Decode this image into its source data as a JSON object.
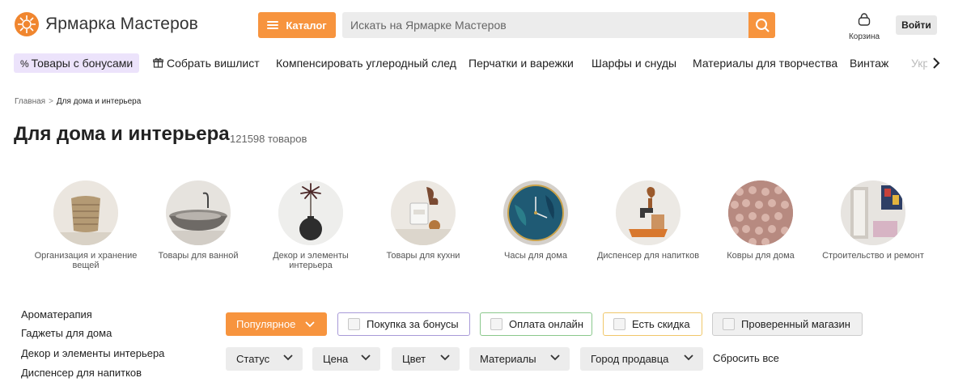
{
  "header": {
    "logo_text": "Ярмарка Мастеров",
    "logo_icon": "sun-flower-icon",
    "catalog_label": "Каталог",
    "search_placeholder": "Искать на Ярмарке Мастеров",
    "cart_label": "Корзина",
    "login_label": "Войти",
    "accent_color": "#f7943e"
  },
  "nav": {
    "items": [
      {
        "label": "Товары с бонусами",
        "icon": "percent-icon"
      },
      {
        "label": "Собрать вишлист",
        "icon": "gift-icon"
      },
      {
        "label": "Компенсировать углеродный след"
      },
      {
        "label": "Перчатки и варежки"
      },
      {
        "label": "Шарфы и снуды"
      },
      {
        "label": "Материалы для творчества"
      },
      {
        "label": "Винтаж"
      },
      {
        "label": "Укр"
      }
    ]
  },
  "breadcrumb": {
    "home": "Главная",
    "separator": ">",
    "current": "Для дома и интерьера"
  },
  "page": {
    "title": "Для дома и интерьера",
    "count": "121598 товаров"
  },
  "categories": [
    {
      "label": "Организация и хранение вещей"
    },
    {
      "label": "Товары для ванной"
    },
    {
      "label": "Декор и элементы интерьера"
    },
    {
      "label": "Товары для кухни"
    },
    {
      "label": "Часы для дома"
    },
    {
      "label": "Диспенсер для напитков"
    },
    {
      "label": "Ковры для дома"
    },
    {
      "label": "Строительство и ремонт"
    }
  ],
  "sidebar": {
    "links": [
      "Ароматерапия",
      "Гаджеты для дома",
      "Декор и элементы интерьера",
      "Диспенсер для напитков"
    ]
  },
  "filters": {
    "sort_label": "Популярное",
    "chips": [
      "Покупка за бонусы",
      "Оплата онлайн",
      "Есть скидка",
      "Проверенный магазин"
    ],
    "dropdowns": [
      "Статус",
      "Цена",
      "Цвет",
      "Материалы",
      "Город продавца"
    ],
    "reset_label": "Сбросить все"
  }
}
